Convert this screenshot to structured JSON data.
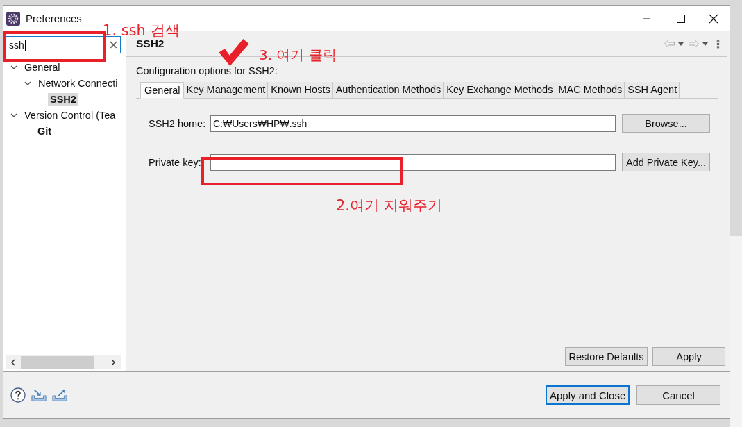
{
  "window": {
    "title": "Preferences"
  },
  "search": {
    "value": "ssh"
  },
  "tree": [
    {
      "label": "General",
      "expanded": true,
      "selected": false,
      "matched": false,
      "children": [
        {
          "label": "Network Connecti",
          "expanded": true,
          "selected": false,
          "matched": false,
          "children": [
            {
              "label": "SSH2",
              "selected": true,
              "matched": true
            }
          ]
        }
      ]
    },
    {
      "label": "Version Control (Tea",
      "expanded": true,
      "selected": false,
      "matched": false,
      "children": [
        {
          "label": "Git",
          "selected": false,
          "matched": true
        }
      ]
    }
  ],
  "page": {
    "title": "SSH2",
    "description": "Configuration options for SSH2:"
  },
  "tabs": [
    {
      "label": "General",
      "selected": true
    },
    {
      "label": "Key Management",
      "selected": false
    },
    {
      "label": "Known Hosts",
      "selected": false
    },
    {
      "label": "Authentication Methods",
      "selected": false
    },
    {
      "label": "Key Exchange Methods",
      "selected": false
    },
    {
      "label": "MAC Methods",
      "selected": false
    },
    {
      "label": "SSH Agent",
      "selected": false
    }
  ],
  "fields": [
    {
      "label": "SSH2 home:",
      "value": "C:₩Users₩HP₩.ssh",
      "button": "Browse..."
    },
    {
      "label": "Private key:",
      "button": "Add Private Key..."
    }
  ],
  "page_buttons": [
    "Restore Defaults",
    "Apply"
  ],
  "dialog_buttons": [
    {
      "label": "Apply and Close",
      "default": true
    },
    {
      "label": "Cancel",
      "default": false
    }
  ],
  "annotations": [
    "1. ssh 검색",
    "3. 여기 클릭",
    "2.여기 지워주기"
  ]
}
